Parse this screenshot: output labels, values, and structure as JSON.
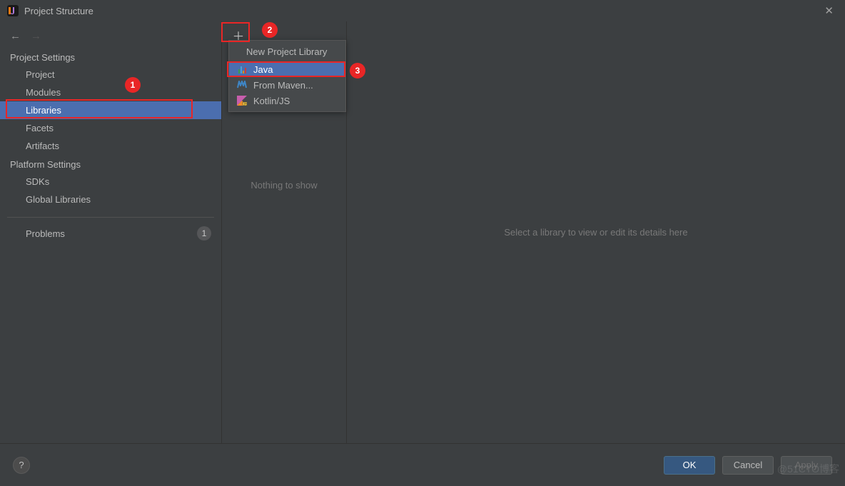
{
  "window": {
    "title": "Project Structure"
  },
  "sidebar": {
    "section1": "Project Settings",
    "items1": [
      "Project",
      "Modules",
      "Libraries",
      "Facets",
      "Artifacts"
    ],
    "selected_index1": 2,
    "section2": "Platform Settings",
    "items2": [
      "SDKs",
      "Global Libraries"
    ],
    "problems_label": "Problems",
    "problems_count": "1"
  },
  "midcol": {
    "nothing_label": "Nothing to show"
  },
  "popup": {
    "header": "New Project Library",
    "items": [
      "Java",
      "From Maven...",
      "Kotlin/JS"
    ],
    "selected_index": 0
  },
  "detail": {
    "placeholder": "Select a library to view or edit its details here"
  },
  "buttons": {
    "ok": "OK",
    "cancel": "Cancel",
    "apply": "Apply"
  },
  "annotations": {
    "n1": "1",
    "n2": "2",
    "n3": "3"
  },
  "watermark": "@51CTO博客"
}
